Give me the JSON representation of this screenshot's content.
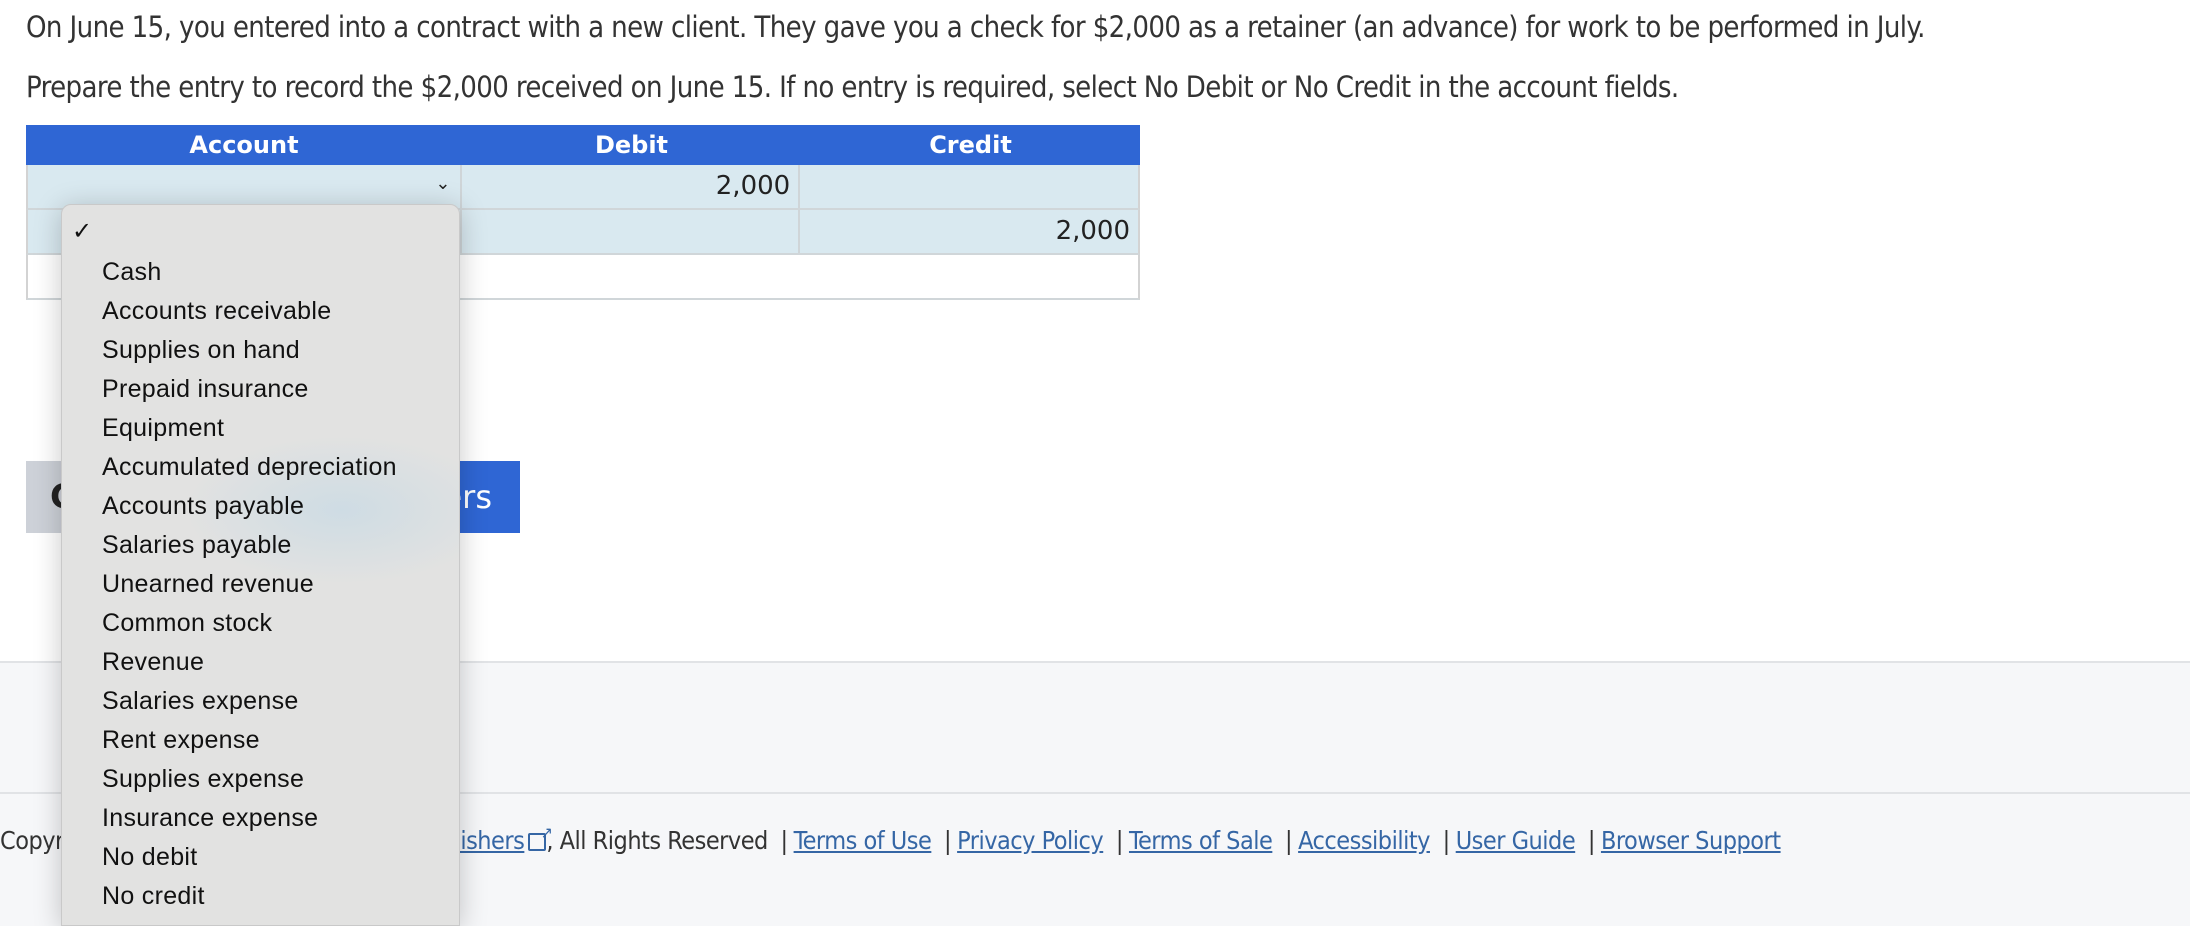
{
  "question": {
    "line1": "On June 15, you entered into a contract with a new client. They gave you a check for $2,000 as a retainer (an advance) for work to be performed in July.",
    "line2": "Prepare the entry to record the $2,000 received on June 15. If no entry is required, select No Debit or No Credit in the account fields."
  },
  "journal": {
    "headers": {
      "account": "Account",
      "debit": "Debit",
      "credit": "Credit"
    },
    "rows": [
      {
        "account": "",
        "debit": "2,000",
        "credit": ""
      },
      {
        "account": "",
        "debit": "",
        "credit": "2,000"
      },
      {
        "account": "",
        "debit": "",
        "credit": ""
      }
    ]
  },
  "buttons": {
    "grey_visible": "C",
    "blue_visible": "ers"
  },
  "footer": {
    "prefix_visible": "Copyr",
    "publisher_visible": "blishers",
    "rights": ", All Rights Reserved",
    "links": [
      "Terms of Use",
      "Privacy Policy",
      "Terms of Sale",
      "Accessibility",
      "User Guide",
      "Browser Support"
    ]
  },
  "dropdown": {
    "selected_marker": "✓",
    "options": [
      "Cash",
      "Accounts receivable",
      "Supplies on hand",
      "Prepaid insurance",
      "Equipment",
      "Accumulated depreciation",
      "Accounts payable",
      "Salaries payable",
      "Unearned revenue",
      "Common stock",
      "Revenue",
      "Salaries expense",
      "Rent expense",
      "Supplies expense",
      "Insurance expense",
      "No debit",
      "No credit"
    ]
  },
  "colors": {
    "header_blue": "#2f66d4",
    "row_fill": "#d9e9f0",
    "link": "#3566a5",
    "dropdown_bg": "#e2e2e1"
  }
}
